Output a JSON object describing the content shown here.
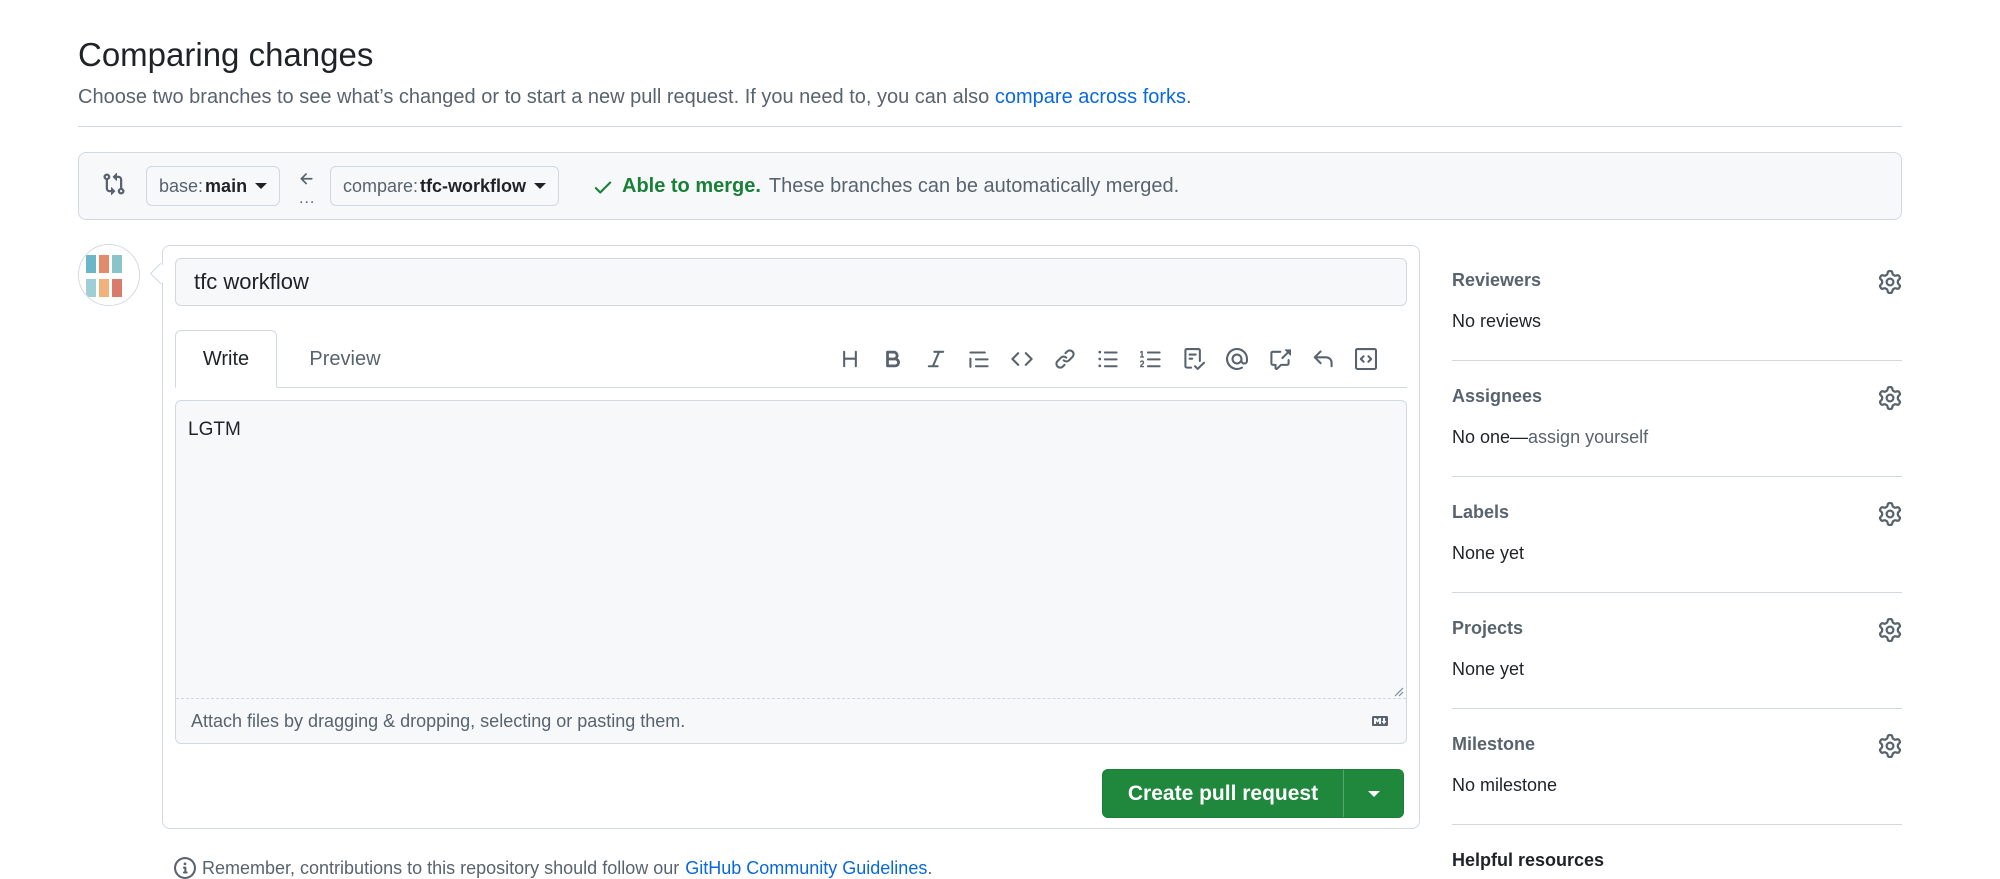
{
  "header": {
    "title": "Comparing changes",
    "subtitle": "Choose two branches to see what’s changed or to start a new pull request. If you need to, you can also",
    "forks_link": "compare across forks",
    "forks_period": "."
  },
  "range": {
    "base_prefix": "base: ",
    "base_branch": "main",
    "compare_prefix": "compare: ",
    "compare_branch": "tfc-workflow",
    "dots": "...",
    "merge_ok": "Able to merge.",
    "merge_text": "These branches can be automatically merged."
  },
  "composer": {
    "title_value": "tfc workflow",
    "tabs": {
      "write": "Write",
      "preview": "Preview"
    },
    "toolbar_icons": [
      "heading-icon",
      "bold-icon",
      "italic-icon",
      "quote-icon",
      "code-icon",
      "link-icon",
      "unordered-list-icon",
      "ordered-list-icon",
      "task-list-icon",
      "mention-icon",
      "cross-reference-icon",
      "reply-icon",
      "slash-commands-icon"
    ],
    "body_value": "LGTM",
    "attach_hint": "Attach files by dragging & dropping, selecting or pasting them.",
    "create_label": "Create pull request"
  },
  "guidelines": {
    "text": "Remember, contributions to this repository should follow our",
    "link": "GitHub Community Guidelines",
    "period": "."
  },
  "sidebar": {
    "reviewers": {
      "label": "Reviewers",
      "value": "No reviews"
    },
    "assignees": {
      "label": "Assignees",
      "value": "No one—",
      "action": "assign yourself"
    },
    "labels": {
      "label": "Labels",
      "value": "None yet"
    },
    "projects": {
      "label": "Projects",
      "value": "None yet"
    },
    "milestone": {
      "label": "Milestone",
      "value": "No milestone"
    },
    "helpful": {
      "label": "Helpful resources"
    }
  },
  "colors": {
    "primary_green": "#1f883d",
    "link_blue": "#0969da",
    "success_text": "#1a7f37",
    "border": "#d1d9e0",
    "muted_text": "#59636e"
  }
}
